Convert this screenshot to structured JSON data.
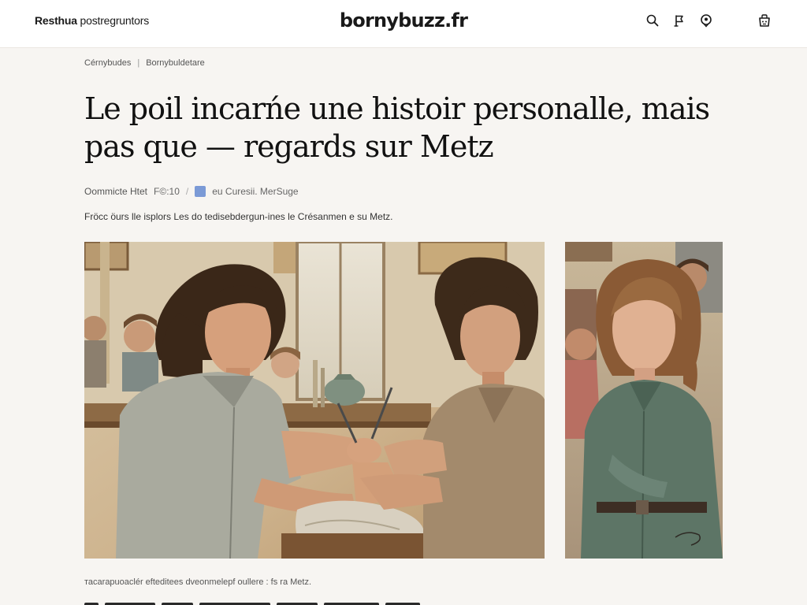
{
  "header": {
    "brand_bold": "Resthua",
    "brand_rest": " postregruntors",
    "site_name": "bornybuzz.fr",
    "icons": [
      "search-icon",
      "flag-icon",
      "location-pin-icon",
      "cart-icon"
    ]
  },
  "breadcrumb": {
    "items": [
      "Cérnybudes",
      "Bornybuldetare"
    ],
    "separator": "|"
  },
  "article": {
    "headline": "Le poil incarńe une histoir personalle, mais pas que — regards sur Metz",
    "meta_author": "Oommicte Htet",
    "meta_date": "F©:10",
    "meta_separator": "/",
    "meta_source": "eu Curesii. MerSuge",
    "standfirst": "Fröcc öurs lle isplors Les do tedisebdergun-ines le Crésanmen e su Metz.",
    "caption": "тасаrapuoaclér efteditees dveonmelepf oullere : fs ra Metz."
  },
  "colors": {
    "background": "#f7f5f2",
    "header_bg": "#ffffff",
    "headline": "#111111",
    "meta_badge": "#7b9ad6"
  }
}
